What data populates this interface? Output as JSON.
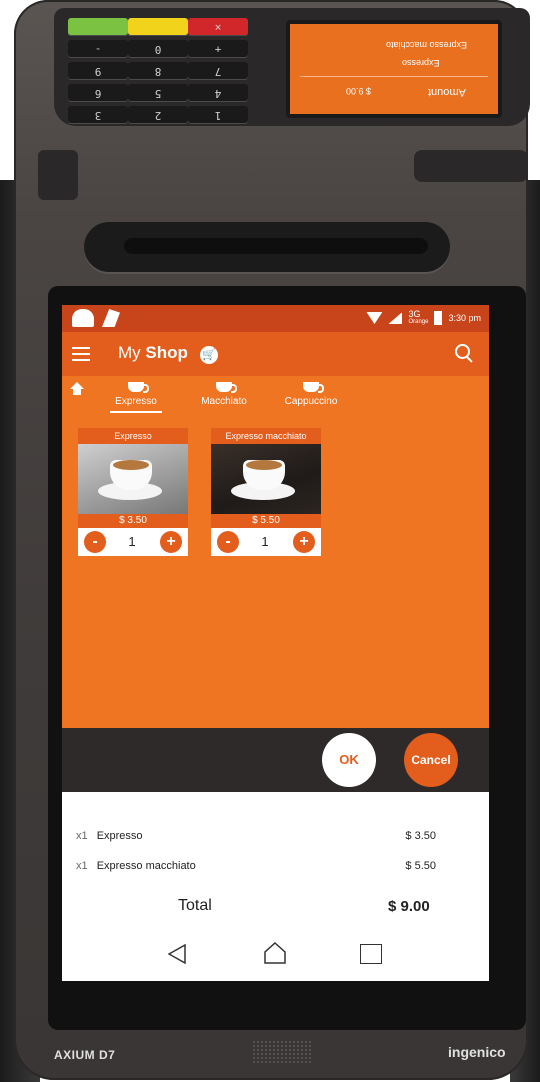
{
  "device": {
    "model_label": "AXIUM D7",
    "brand_label": "ingenico",
    "top_brand_label": "ingenico"
  },
  "pinpad": {
    "keys": [
      "✕",
      "",
      "",
      "+",
      "0",
      "-",
      "7",
      "8",
      "9",
      "4",
      "5",
      "6",
      "1",
      "2",
      "3"
    ],
    "mini_screen": {
      "line1": "Expresso macchiato",
      "line2": "Expresso",
      "amount_label": "Amount",
      "amount_value": "$ 9.00"
    }
  },
  "statusbar": {
    "network": "3G",
    "carrier": "Orange",
    "time": "3:30 pm"
  },
  "appbar": {
    "title_prefix": "My",
    "title_bold": "Shop"
  },
  "tabs": [
    {
      "label": "Expresso",
      "active": true
    },
    {
      "label": "Macchiato",
      "active": false
    },
    {
      "label": "Cappuccino",
      "active": false
    }
  ],
  "products": [
    {
      "name": "Expresso",
      "price": "$ 3.50",
      "qty": "1"
    },
    {
      "name": "Expresso macchiato",
      "price": "$ 5.50",
      "qty": "1"
    }
  ],
  "actions": {
    "ok": "OK",
    "cancel": "Cancel"
  },
  "summary": {
    "items": [
      {
        "qty": "x1",
        "name": "Expresso",
        "price": "$ 3.50"
      },
      {
        "qty": "x1",
        "name": "Expresso macchiato",
        "price": "$ 5.50"
      }
    ],
    "total_label": "Total",
    "total_value": "$ 9.00"
  },
  "colors": {
    "accent": "#e35d1d",
    "content_bg": "#f07522",
    "statusbar": "#c8451c"
  }
}
